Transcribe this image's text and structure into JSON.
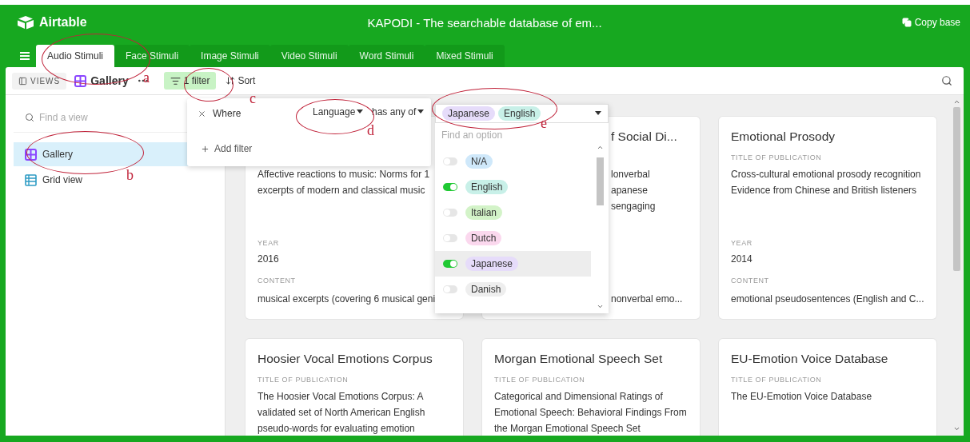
{
  "header": {
    "logo": "Airtable",
    "title": "KAPODI - The searchable database of em...",
    "copy_button": "Copy base"
  },
  "tabs": [
    {
      "label": "Audio Stimuli",
      "selected": true
    },
    {
      "label": "Face Stimuli",
      "selected": false
    },
    {
      "label": "Image Stimuli",
      "selected": false
    },
    {
      "label": "Video Stimuli",
      "selected": false
    },
    {
      "label": "Word Stimuli",
      "selected": false
    },
    {
      "label": "Mixed Stimuli",
      "selected": false
    }
  ],
  "toolbar": {
    "views": "VIEWS",
    "view_name": "Gallery",
    "filter": "1 filter",
    "sort": "Sort"
  },
  "sidebar": {
    "search": {
      "placeholder": "Find a view"
    },
    "items": [
      {
        "label": "Gallery",
        "kind": "gallery",
        "selected": true
      },
      {
        "label": "Grid view",
        "kind": "grid",
        "selected": false
      }
    ]
  },
  "filter_popup": {
    "where": "Where",
    "field": "Language",
    "operator": "has any of",
    "add": "Add filter"
  },
  "select": {
    "values": [
      {
        "label": "Japanese",
        "color": "#e6dcfa"
      },
      {
        "label": "English",
        "color": "#c8f0e8"
      }
    ],
    "search": {
      "placeholder": "Find an option"
    },
    "options": [
      {
        "label": "N/A",
        "color": "#cfe8fa",
        "on": false,
        "highlighted": false
      },
      {
        "label": "English",
        "color": "#c8f0e8",
        "on": true,
        "highlighted": false
      },
      {
        "label": "Italian",
        "color": "#d3f3c8",
        "on": false,
        "highlighted": false
      },
      {
        "label": "Dutch",
        "color": "#fbd8ee",
        "on": false,
        "highlighted": false
      },
      {
        "label": "Japanese",
        "color": "#e6dcfa",
        "on": true,
        "highlighted": true
      },
      {
        "label": "Danish",
        "color": "#eeeeee",
        "on": false,
        "highlighted": false
      }
    ]
  },
  "cards": [
    {
      "fields": [
        {
          "kind": "publication",
          "value": "Affective reactions to music: Norms for 1\nexcerpts of modern and classical music"
        },
        {
          "kind": "year_label",
          "label": "YEAR"
        },
        {
          "kind": "year",
          "value": "2016"
        },
        {
          "kind": "content_label",
          "label": "CONTENT"
        },
        {
          "kind": "content",
          "value": "musical excerpts (covering 6 musical geni"
        }
      ]
    },
    {
      "title": "f Social Di...",
      "fields": [
        {
          "kind": "publication",
          "value": "lonverbal\napanese\nsengaging"
        },
        {
          "kind": "content",
          "value": "nonverbal emo..."
        }
      ]
    },
    {
      "title": "Emotional Prosody",
      "fields": [
        {
          "kind": "publication_label",
          "label": "TITLE OF PUBLICATION"
        },
        {
          "kind": "publication",
          "value": "Cross-cultural emotional prosody recognition Evidence from Chinese and British listeners"
        },
        {
          "kind": "year_label",
          "label": "YEAR"
        },
        {
          "kind": "year",
          "value": "2014"
        },
        {
          "kind": "content_label",
          "label": "CONTENT"
        },
        {
          "kind": "content",
          "value": "emotional pseudosentences (English and C..."
        }
      ]
    },
    {
      "title": "Hoosier Vocal Emotions Corpus",
      "fields": [
        {
          "kind": "publication_label",
          "label": "TITLE OF PUBLICATION"
        },
        {
          "kind": "publication",
          "value": "The Hoosier Vocal Emotions Corpus: A validated set of North American English pseudo-words for evaluating emotion"
        }
      ]
    },
    {
      "title": "Morgan Emotional Speech Set",
      "fields": [
        {
          "kind": "publication_label",
          "label": "TITLE OF PUBLICATION"
        },
        {
          "kind": "publication",
          "value": "Categorical and Dimensional Ratings of Emotional Speech: Behavioral Findings From the Morgan Emotional Speech Set"
        }
      ]
    },
    {
      "title": "EU-Emotion Voice Database",
      "fields": [
        {
          "kind": "publication_label",
          "label": "TITLE OF PUBLICATION"
        },
        {
          "kind": "publication",
          "value": "The EU-Emotion Voice Database"
        }
      ]
    }
  ],
  "annotations": [
    {
      "label": "a"
    },
    {
      "label": "b"
    },
    {
      "label": "c"
    },
    {
      "label": "d"
    },
    {
      "label": "e"
    }
  ]
}
